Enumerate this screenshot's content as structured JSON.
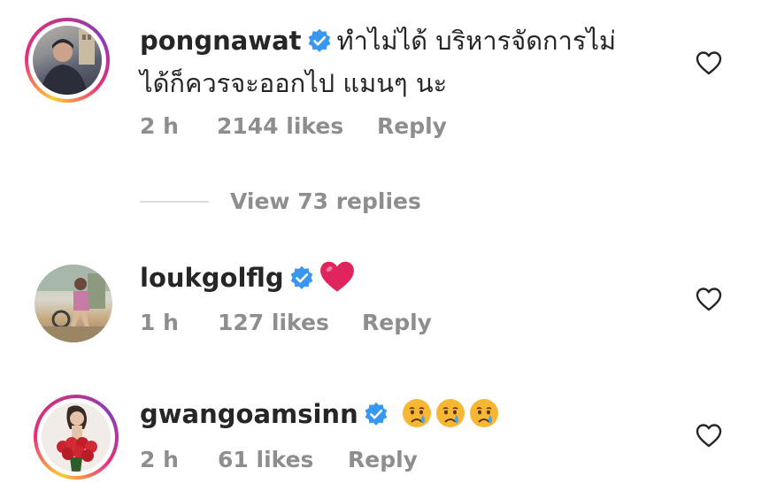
{
  "comments": [
    {
      "username": "pongnawat",
      "verified": true,
      "text_line1": "ทำไม่ได้ บริหารจัดการไม่",
      "text_line2": "ได้ก็ควรจะออกไป แมนๆ นะ",
      "time": "2 h",
      "likes": "2144 likes",
      "reply": "Reply",
      "view_replies": "View 73 replies"
    },
    {
      "username": "loukgolflg",
      "verified": true,
      "text": "❤️",
      "time": "1 h",
      "likes": "127 likes",
      "reply": "Reply"
    },
    {
      "username": "gwangoamsinn",
      "verified": true,
      "text": "😢😢😢",
      "time": "2 h",
      "likes": "61 likes",
      "reply": "Reply"
    }
  ],
  "colors": {
    "verified_blue": "#3897f0",
    "text_primary": "#262626",
    "text_secondary": "#8e8e8e",
    "heart_red": "#e0245e"
  },
  "icons": {
    "verified": "verified-badge-icon",
    "like": "heart-outline-icon"
  }
}
